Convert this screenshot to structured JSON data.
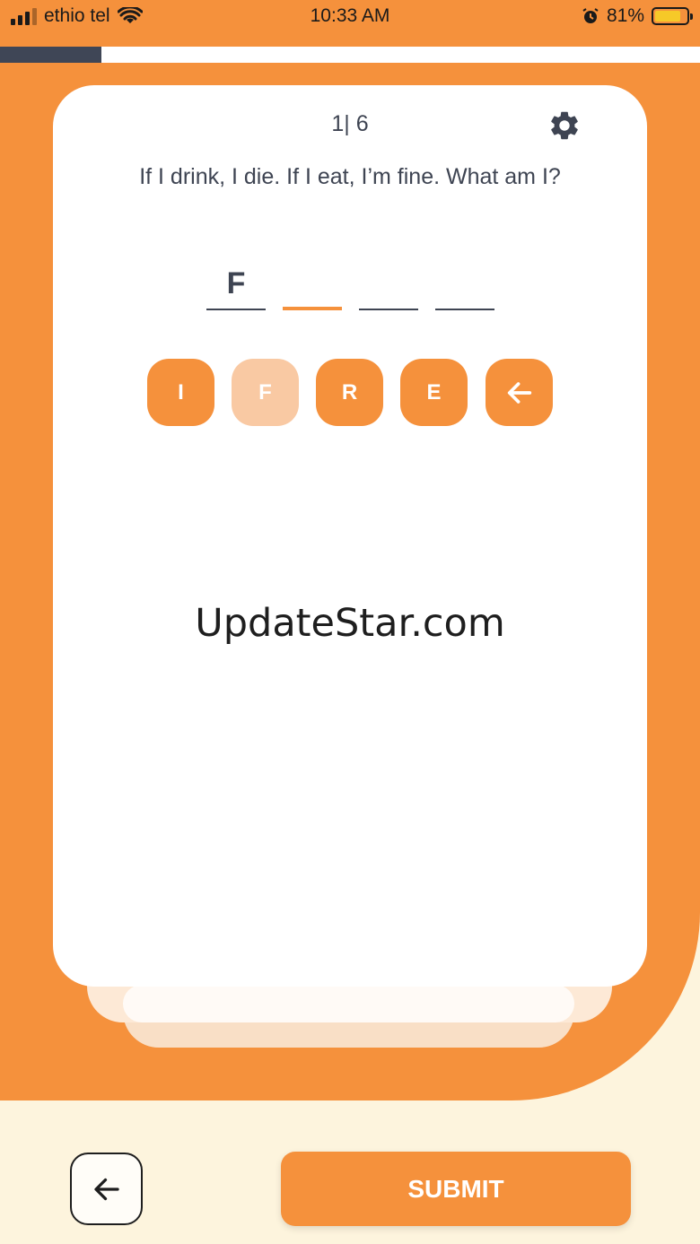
{
  "status_bar": {
    "carrier": "ethio tel",
    "time": "10:33 AM",
    "battery_percent": "81%",
    "battery_level": 0.81,
    "battery_color": "#f6c928"
  },
  "progress": {
    "fraction": 0.145,
    "fill_color": "#3f4656"
  },
  "quiz": {
    "counter": "1| 6",
    "question": "If I drink, I die. If I eat, I’m fine. What am I?",
    "answer_slots": [
      "F",
      "",
      "",
      ""
    ],
    "active_slot": 1,
    "letters": [
      {
        "letter": "I",
        "used": false
      },
      {
        "letter": "F",
        "used": true
      },
      {
        "letter": "R",
        "used": false
      },
      {
        "letter": "E",
        "used": false
      }
    ]
  },
  "watermark": "UpdateStar.com",
  "footer": {
    "submit_label": "SUBMIT"
  },
  "icons": {
    "settings": "gear-icon",
    "backspace": "arrow-left-icon",
    "back": "arrow-left-icon"
  },
  "colors": {
    "accent": "#f5913c",
    "accent_light": "#f9c9a3",
    "text": "#3e4452",
    "background": "#fdf4dd"
  }
}
